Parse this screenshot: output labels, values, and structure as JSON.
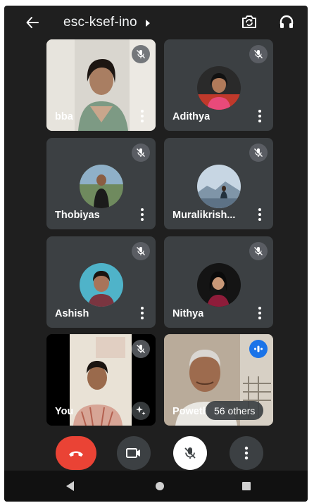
{
  "header": {
    "meeting_code": "esc-ksef-ino",
    "back_icon": "arrow-left-icon",
    "caret_icon": "caret-right-icon",
    "switch_camera_icon": "switch-camera-icon",
    "audio_icon": "headphones-icon"
  },
  "participants": [
    {
      "name": "bba",
      "muted": true,
      "video": true
    },
    {
      "name": "Adithya",
      "muted": true,
      "video": false
    },
    {
      "name": "Thobiyas",
      "muted": true,
      "video": false
    },
    {
      "name": "Muralikrish...",
      "muted": true,
      "video": false
    },
    {
      "name": "Ashish",
      "muted": true,
      "video": false
    },
    {
      "name": "Nithya",
      "muted": true,
      "video": false
    },
    {
      "name": "You",
      "muted": true,
      "video": true
    },
    {
      "name": "Poweth",
      "muted": false,
      "video": true
    }
  ],
  "others_count_label": "56 others",
  "controls": {
    "end_call_icon": "phone-hangup-icon",
    "camera_icon": "video-camera-icon",
    "mic_icon": "mic-off-icon",
    "more_icon": "more-vertical-icon",
    "colors": {
      "end_call": "#ea4335",
      "camera_bg": "#3c4043",
      "mic_bg": "#ffffff",
      "more_bg": "#3c4043",
      "active_speaker": "#1a73e8"
    }
  },
  "nav": {
    "back_icon": "nav-back-triangle-icon",
    "home_icon": "nav-home-circle-icon",
    "recents_icon": "nav-recents-square-icon"
  }
}
